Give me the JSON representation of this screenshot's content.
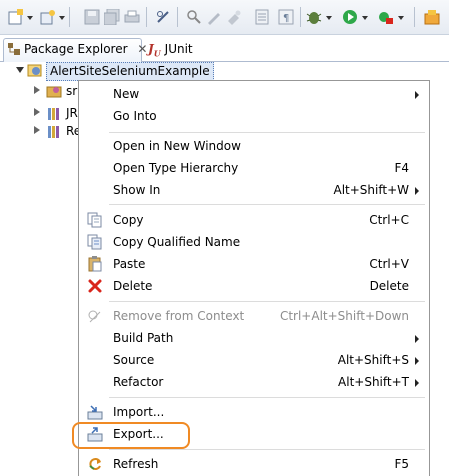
{
  "tabs": [
    {
      "label": "Package Explorer",
      "icon": "package-explorer-icon"
    },
    {
      "label": "JUnit",
      "icon": "junit-icon"
    }
  ],
  "tree": {
    "project": "AlertSiteSeleniumExample",
    "children": [
      "sr",
      "JR",
      "Re"
    ]
  },
  "menu": {
    "new": {
      "label": "New"
    },
    "go_into": {
      "label": "Go Into"
    },
    "open_new_window": {
      "label": "Open in New Window"
    },
    "open_type_hierarchy": {
      "label": "Open Type Hierarchy",
      "accel": "F4"
    },
    "show_in": {
      "label": "Show In",
      "accel": "Alt+Shift+W"
    },
    "copy": {
      "label": "Copy",
      "accel": "Ctrl+C"
    },
    "copy_qualified": {
      "label": "Copy Qualified Name"
    },
    "paste": {
      "label": "Paste",
      "accel": "Ctrl+V"
    },
    "delete": {
      "label": "Delete",
      "accel": "Delete"
    },
    "remove_context": {
      "label": "Remove from Context",
      "accel": "Ctrl+Alt+Shift+Down"
    },
    "build_path": {
      "label": "Build Path"
    },
    "source": {
      "label": "Source",
      "accel": "Alt+Shift+S"
    },
    "refactor": {
      "label": "Refactor",
      "accel": "Alt+Shift+T"
    },
    "import": {
      "label": "Import..."
    },
    "export": {
      "label": "Export..."
    },
    "refresh": {
      "label": "Refresh",
      "accel": "F5"
    }
  },
  "colors": {
    "highlight_ring": "#f08a24",
    "delete_red": "#d9261c",
    "run_green": "#2ea84a"
  }
}
